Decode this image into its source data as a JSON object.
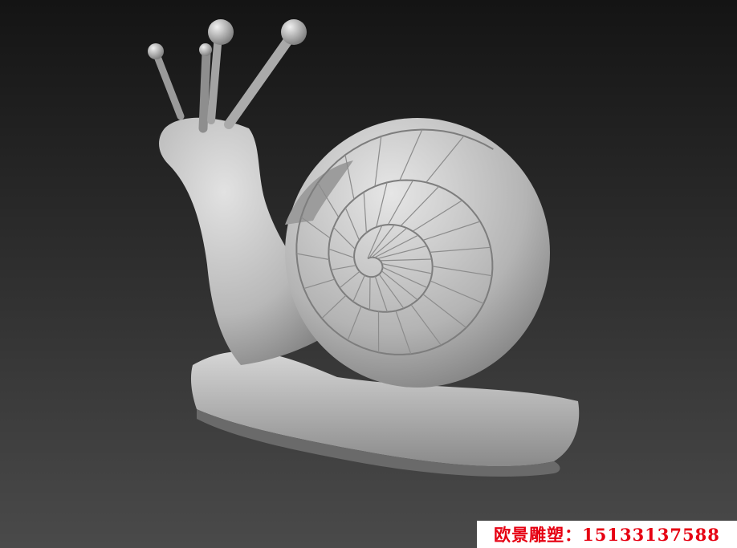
{
  "scene": {
    "subject": "snail-sculpture-render",
    "background_top": "#141414",
    "background_bottom": "#4a4a4a",
    "model_color": "#bdbdbd"
  },
  "caption": {
    "text": "欧景雕塑：15133137588",
    "color": "#e60012",
    "background": "#ffffff"
  }
}
